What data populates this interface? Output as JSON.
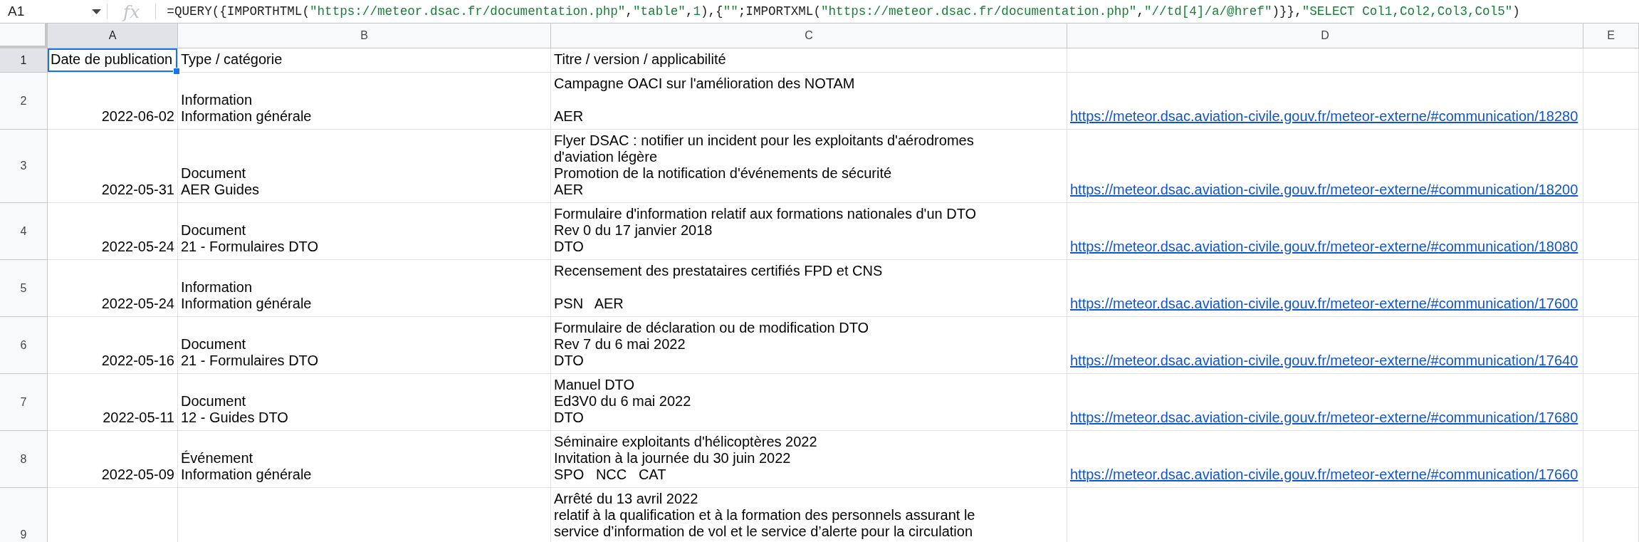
{
  "formula_bar": {
    "name_box": "A1",
    "function_label": "fx",
    "formula": [
      {
        "kind": "plain",
        "text": "=QUERY({IMPORTHTML("
      },
      {
        "kind": "string",
        "text": "\"https://meteor.dsac.fr/documentation.php\""
      },
      {
        "kind": "plain",
        "text": ","
      },
      {
        "kind": "string",
        "text": "\"table\""
      },
      {
        "kind": "plain",
        "text": ","
      },
      {
        "kind": "number",
        "text": "1"
      },
      {
        "kind": "plain",
        "text": "),{"
      },
      {
        "kind": "string",
        "text": "\"\""
      },
      {
        "kind": "plain",
        "text": ";IMPORTXML("
      },
      {
        "kind": "string",
        "text": "\"https://meteor.dsac.fr/documentation.php\""
      },
      {
        "kind": "plain",
        "text": ","
      },
      {
        "kind": "string",
        "text": "\"//td[4]/a/@href\""
      },
      {
        "kind": "plain",
        "text": ")}},"
      },
      {
        "kind": "string",
        "text": "\"SELECT Col1,Col2,Col3,Col5\""
      },
      {
        "kind": "plain",
        "text": ")"
      }
    ]
  },
  "columns": [
    {
      "label": "A",
      "selected": true
    },
    {
      "label": "B",
      "selected": false
    },
    {
      "label": "C",
      "selected": false
    },
    {
      "label": "D",
      "selected": false
    },
    {
      "label": "E",
      "selected": false
    }
  ],
  "rows": [
    {
      "number": "1",
      "selected": true,
      "cells": [
        {
          "kind": "text",
          "text": "Date de publication",
          "selected": true
        },
        {
          "kind": "text",
          "text": "Type / catégorie",
          "selected": false
        },
        {
          "kind": "text",
          "text": "Titre / version / applicabilité",
          "selected": false
        },
        {
          "kind": "empty",
          "selected": false
        },
        {
          "kind": "empty",
          "selected": false
        }
      ]
    },
    {
      "number": "2",
      "selected": false,
      "cells": [
        {
          "kind": "date",
          "text": "2022-06-02",
          "selected": false
        },
        {
          "kind": "text",
          "text": "Information\nInformation générale",
          "selected": false
        },
        {
          "kind": "text",
          "text": "Campagne OACI sur l'amélioration des NOTAM\n\nAER",
          "selected": false
        },
        {
          "kind": "link",
          "text": "https://meteor.dsac.aviation-civile.gouv.fr/meteor-externe/#communication/18280",
          "selected": false
        },
        {
          "kind": "empty",
          "selected": false
        }
      ]
    },
    {
      "number": "3",
      "selected": false,
      "cells": [
        {
          "kind": "date",
          "text": "2022-05-31",
          "selected": false
        },
        {
          "kind": "text",
          "text": "Document\nAER Guides",
          "selected": false
        },
        {
          "kind": "text",
          "text": "Flyer DSAC : notifier un incident pour les exploitants d'aérodromes\nd'aviation légère\nPromotion de la notification d'événements de sécurité\nAER",
          "selected": false
        },
        {
          "kind": "link",
          "text": "https://meteor.dsac.aviation-civile.gouv.fr/meteor-externe/#communication/18200",
          "selected": false
        },
        {
          "kind": "empty",
          "selected": false
        }
      ]
    },
    {
      "number": "4",
      "selected": false,
      "cells": [
        {
          "kind": "date",
          "text": "2022-05-24",
          "selected": false
        },
        {
          "kind": "text",
          "text": "Document\n21 - Formulaires DTO",
          "selected": false
        },
        {
          "kind": "text",
          "text": "Formulaire d'information relatif aux formations nationales d'un DTO\nRev 0 du 17 janvier 2018\nDTO",
          "selected": false
        },
        {
          "kind": "link",
          "text": "https://meteor.dsac.aviation-civile.gouv.fr/meteor-externe/#communication/18080",
          "selected": false
        },
        {
          "kind": "empty",
          "selected": false
        }
      ]
    },
    {
      "number": "5",
      "selected": false,
      "cells": [
        {
          "kind": "date",
          "text": "2022-05-24",
          "selected": false
        },
        {
          "kind": "text",
          "text": "Information\nInformation générale",
          "selected": false
        },
        {
          "kind": "text",
          "text": "Recensement des prestataires certifiés FPD et CNS\n\nPSN   AER",
          "selected": false
        },
        {
          "kind": "link",
          "text": "https://meteor.dsac.aviation-civile.gouv.fr/meteor-externe/#communication/17600",
          "selected": false
        },
        {
          "kind": "empty",
          "selected": false
        }
      ]
    },
    {
      "number": "6",
      "selected": false,
      "cells": [
        {
          "kind": "date",
          "text": "2022-05-16",
          "selected": false
        },
        {
          "kind": "text",
          "text": "Document\n21 - Formulaires DTO",
          "selected": false
        },
        {
          "kind": "text",
          "text": "Formulaire de déclaration ou de modification DTO\nRev 7 du 6 mai 2022\nDTO",
          "selected": false
        },
        {
          "kind": "link",
          "text": "https://meteor.dsac.aviation-civile.gouv.fr/meteor-externe/#communication/17640",
          "selected": false
        },
        {
          "kind": "empty",
          "selected": false
        }
      ]
    },
    {
      "number": "7",
      "selected": false,
      "cells": [
        {
          "kind": "date",
          "text": "2022-05-11",
          "selected": false
        },
        {
          "kind": "text",
          "text": "Document\n12 - Guides DTO",
          "selected": false
        },
        {
          "kind": "text",
          "text": "Manuel DTO\nEd3V0 du 6 mai 2022\nDTO",
          "selected": false
        },
        {
          "kind": "link",
          "text": "https://meteor.dsac.aviation-civile.gouv.fr/meteor-externe/#communication/17680",
          "selected": false
        },
        {
          "kind": "empty",
          "selected": false
        }
      ]
    },
    {
      "number": "8",
      "selected": false,
      "cells": [
        {
          "kind": "date",
          "text": "2022-05-09",
          "selected": false
        },
        {
          "kind": "text",
          "text": "Événement\nInformation générale",
          "selected": false
        },
        {
          "kind": "text",
          "text": "Séminaire exploitants d'hélicoptères 2022\nInvitation à la journée du 30 juin 2022\nSPO   NCC   CAT",
          "selected": false
        },
        {
          "kind": "link",
          "text": "https://meteor.dsac.aviation-civile.gouv.fr/meteor-externe/#communication/17660",
          "selected": false
        },
        {
          "kind": "empty",
          "selected": false
        }
      ]
    },
    {
      "number": "9",
      "selected": false,
      "cells": [
        {
          "kind": "empty",
          "selected": false
        },
        {
          "kind": "empty",
          "selected": false
        },
        {
          "kind": "text",
          "text": "Arrêté du 13 avril 2022\nrelatif à la qualification et à la formation des personnels assurant le\nservice d’information de vol et le service d’alerte pour la circulation",
          "selected": false
        },
        {
          "kind": "empty",
          "selected": false
        },
        {
          "kind": "empty",
          "selected": false
        }
      ]
    }
  ]
}
